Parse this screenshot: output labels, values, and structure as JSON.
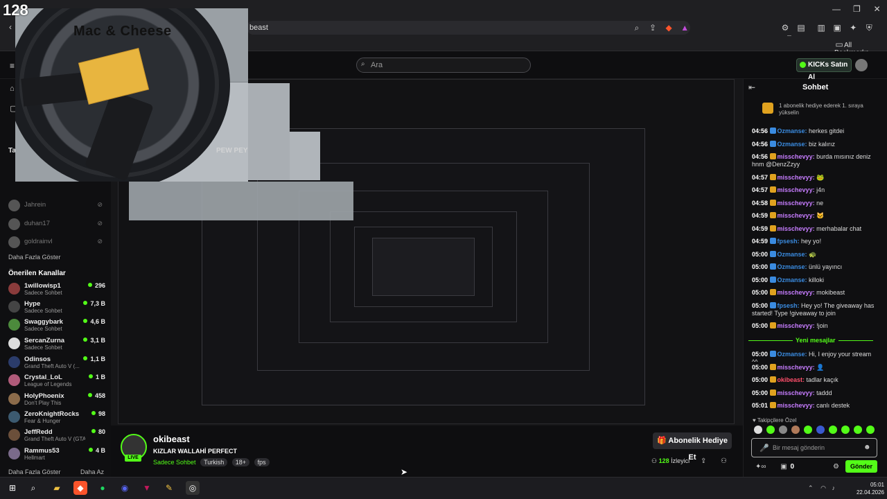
{
  "overlay": {
    "counter": "128",
    "title": "Mac & Cheese",
    "watermark": "PEW PEY"
  },
  "browser": {
    "url": "beast",
    "bookmarks_label": "All Bookmarks"
  },
  "header": {
    "search_placeholder": "Ara",
    "kicks_button": "KICKs Satın Al"
  },
  "sidebar": {
    "partial_label": "Ta",
    "offline": [
      {
        "name": "Jahrein"
      },
      {
        "name": "duhan17"
      },
      {
        "name": "goldrainvl"
      }
    ],
    "show_more": "Daha Fazla Göster",
    "recommended_title": "Önerilen Kanallar",
    "recommended": [
      {
        "name": "1willowisp1",
        "sub": "Sadece Sohbet",
        "viewers": "296"
      },
      {
        "name": "Hype",
        "sub": "Sadece Sohbet",
        "viewers": "7,3 B"
      },
      {
        "name": "Swaggybark",
        "sub": "Sadece Sohbet",
        "viewers": "4,6 B"
      },
      {
        "name": "SercanZurna",
        "sub": "Sadece Sohbet",
        "viewers": "3,1 B"
      },
      {
        "name": "Odinsos",
        "sub": "Grand Theft Auto V (...",
        "viewers": "1,1 B"
      },
      {
        "name": "Crystal_LoL",
        "sub": "League of Legends",
        "viewers": "1 B"
      },
      {
        "name": "HolyPhoenix",
        "sub": "Don't Play This",
        "viewers": "458"
      },
      {
        "name": "ZeroKnightRocks",
        "sub": "Fear & Hunger",
        "viewers": "98"
      },
      {
        "name": "JeffRedd",
        "sub": "Grand Theft Auto V (GTA)",
        "viewers": "80"
      },
      {
        "name": "Rammus53",
        "sub": "Hellmart",
        "viewers": "4 B"
      }
    ],
    "footer_more": "Daha Fazla Göster",
    "footer_less": "Daha Az"
  },
  "stream": {
    "channel": "okibeast",
    "title": "KIZLAR WALLAHİ PERFECT",
    "category": "Sadece Sohbet",
    "tags": [
      "Turkish",
      "18+",
      "fps"
    ],
    "live_badge": "LIVE",
    "gift_button": "Abonelik Hediye Et",
    "viewers": "128",
    "viewers_label": "İzleyici"
  },
  "chat": {
    "title": "Sohbet",
    "pinned": "1 abonelik hediye ederek 1. sıraya yükselin",
    "messages": [
      {
        "time": "04:56",
        "user": "Ozmanse",
        "text": "herkes gitdei",
        "color": "#3a8be0"
      },
      {
        "time": "04:56",
        "user": "Ozmanse",
        "text": "biz kalırız",
        "color": "#3a8be0"
      },
      {
        "time": "04:56",
        "user": "misschevyy",
        "text": "burda mısınız deniz hnm @DenzZzyy",
        "color": "#c77dff"
      },
      {
        "time": "04:57",
        "user": "misschevyy",
        "text": "🐸",
        "color": "#c77dff"
      },
      {
        "time": "04:57",
        "user": "misschevyy",
        "text": "j4n",
        "color": "#c77dff"
      },
      {
        "time": "04:58",
        "user": "misschevyy",
        "text": "ne",
        "color": "#c77dff"
      },
      {
        "time": "04:59",
        "user": "misschevyy",
        "text": "🐱",
        "color": "#c77dff"
      },
      {
        "time": "04:59",
        "user": "misschevyy",
        "text": "merhabalar chat",
        "color": "#c77dff"
      },
      {
        "time": "04:59",
        "user": "fpsesh",
        "text": "hey yo!",
        "color": "#3a8be0"
      },
      {
        "time": "05:00",
        "user": "Ozmanse",
        "text": "🐢",
        "color": "#3a8be0"
      },
      {
        "time": "05:00",
        "user": "Ozmanse",
        "text": "ünlü yayıncı",
        "color": "#3a8be0"
      },
      {
        "time": "05:00",
        "user": "Ozmanse",
        "text": "killoki",
        "color": "#3a8be0"
      },
      {
        "time": "05:00",
        "user": "misschevyy",
        "text": "mokibeast",
        "color": "#c77dff"
      },
      {
        "time": "05:00",
        "user": "fpsesh",
        "text": "Hey yo! The giveaway has started! Type !giveaway to join",
        "color": "#3a8be0"
      },
      {
        "time": "05:00",
        "user": "misschevyy",
        "text": "!join",
        "color": "#c77dff"
      }
    ],
    "new_messages": "Yeni mesajlar",
    "messages2": [
      {
        "time": "05:00",
        "user": "Ozmanse",
        "text": "Hi, I enjoy your stream ^^",
        "color": "#3a8be0"
      },
      {
        "time": "05:00",
        "user": "misschevyy",
        "text": "👤",
        "color": "#c77dff"
      },
      {
        "time": "05:00",
        "user": "okibeast",
        "text": "tadlar kaçık",
        "color": "#ff4f6b"
      },
      {
        "time": "05:00",
        "user": "misschevyy",
        "text": "taddd",
        "color": "#c77dff"
      },
      {
        "time": "05:01",
        "user": "misschevyy",
        "text": "canlı destek",
        "color": "#c77dff"
      }
    ],
    "subscribers_label": "Takipçilere Özel",
    "input_placeholder": "Bir mesaj gönderin",
    "points": "0",
    "send": "Gönder"
  },
  "taskbar": {
    "time": "05:01",
    "date": "22.04.2026"
  },
  "colors": {
    "accent": "#53fc18",
    "bg": "#0e0e10"
  }
}
